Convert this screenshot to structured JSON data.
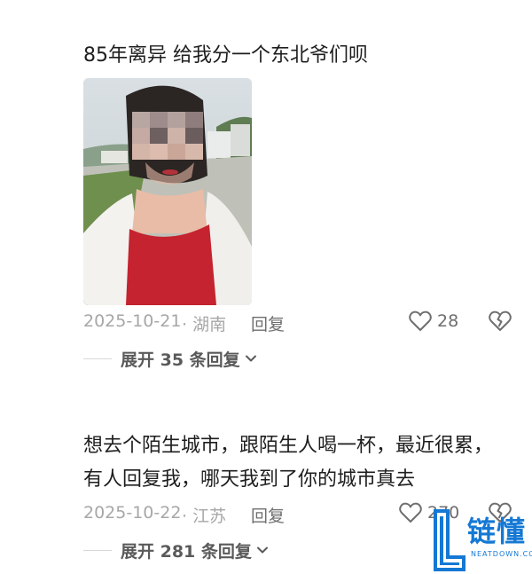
{
  "comments": [
    {
      "text_lines": [
        "85年离异 给我分一个东北爷们呗"
      ],
      "has_photo": true,
      "date": "2025-10-21",
      "region": "· 湖南",
      "reply_label": "回复",
      "likes": "28",
      "expand_label": "展开 35 条回复"
    },
    {
      "text_lines": [
        "想去个陌生城市，跟陌生人喝一杯，最近很累，",
        "有人回复我，哪天我到了你的城市真去"
      ],
      "has_photo": false,
      "date": "2025-10-22",
      "region": "· 江苏",
      "reply_label": "回复",
      "likes": "270",
      "expand_label": "展开 281 条回复"
    }
  ],
  "watermark": {
    "text": "链懂",
    "sub": "NEATDOWN.COM"
  },
  "colors": {
    "meta_gray": "#a7a7a7",
    "action_gray": "#6e6e6e",
    "brand_blue": "#1478d4",
    "dress_red": "#c4232f"
  },
  "icons": [
    "heart-icon",
    "broken-heart-icon",
    "chevron-down-icon"
  ]
}
